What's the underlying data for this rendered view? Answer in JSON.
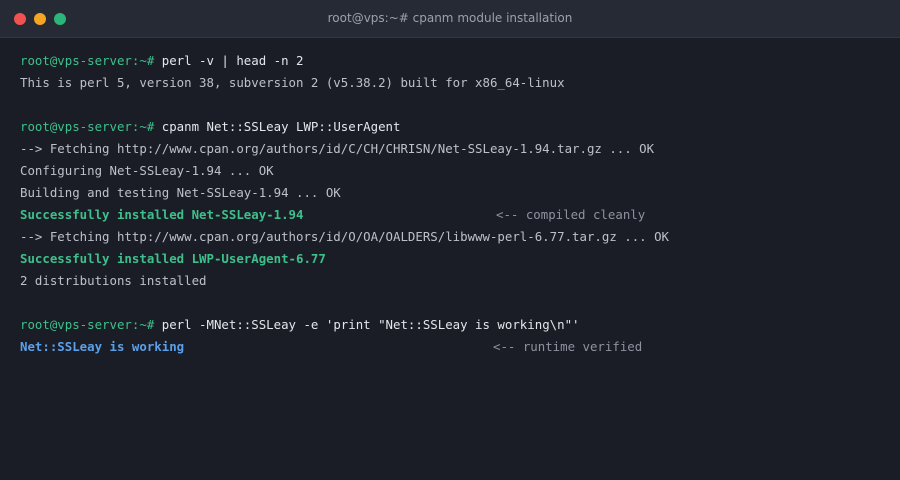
{
  "window": {
    "title": "root@vps:~# cpanm module installation"
  },
  "terminal": {
    "line1": {
      "prompt": "root@vps-server:~#",
      "command": " perl -v | head -n 2"
    },
    "line2": "This is perl 5, version 38, subversion 2 (v5.38.2) built for x86_64-linux",
    "line3": {
      "prompt": "root@vps-server:~#",
      "command": " cpanm Net::SSLeay LWP::UserAgent"
    },
    "line4": "--> Fetching http://www.cpan.org/authors/id/C/CH/CHRISN/Net-SSLeay-1.94.tar.gz ... OK",
    "line5": "Configuring Net-SSLeay-1.94 ... OK",
    "line6": "Building and testing Net-SSLeay-1.94 ... OK",
    "line7": {
      "text": "Successfully installed Net-SSLeay-1.94",
      "note": "<-- compiled cleanly"
    },
    "line8": "--> Fetching http://www.cpan.org/authors/id/O/OA/OALDERS/libwww-perl-6.77.tar.gz ... OK",
    "line9": "Successfully installed LWP-UserAgent-6.77",
    "line10": "2 distributions installed",
    "line11": {
      "prompt": "root@vps-server:~#",
      "command": " perl -MNet::SSLeay -e 'print \"Net::SSLeay is working\\n\"'"
    },
    "line12": {
      "text": "Net::SSLeay is working",
      "note": "<-- runtime verified"
    }
  },
  "colors": {
    "background": "#1b1d26",
    "titlebar": "#262a35",
    "prompt": "#3dc08a",
    "success": "#3dc08a",
    "verified": "#5aa0ea",
    "note": "#8d939e"
  }
}
